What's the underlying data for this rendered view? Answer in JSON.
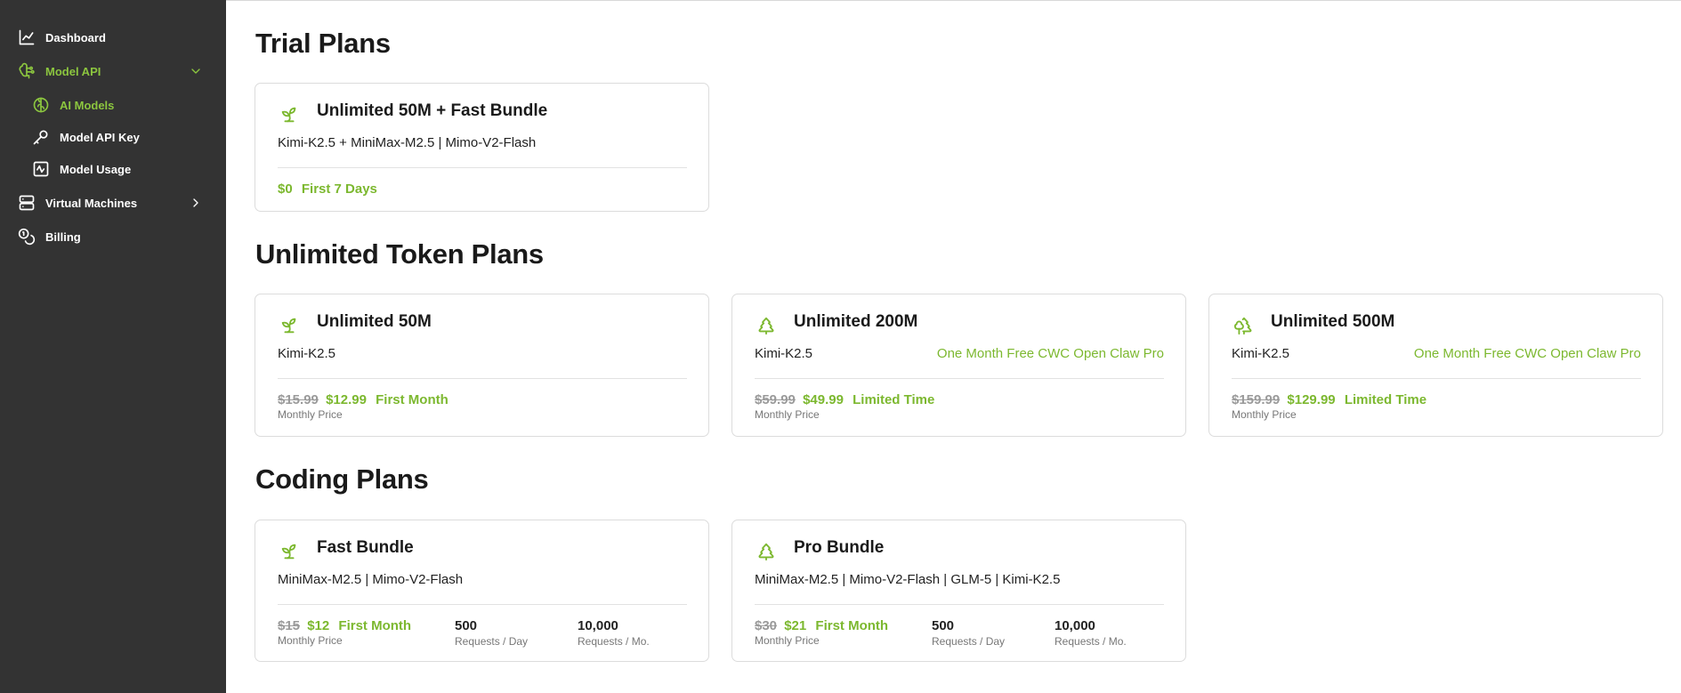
{
  "sidebar": {
    "items": [
      {
        "label": "Dashboard",
        "icon": "chart-line-icon"
      },
      {
        "label": "Model API",
        "icon": "brain-circuit-icon",
        "active": true,
        "expanded": true
      },
      {
        "label": "AI Models",
        "icon": "brain-icon",
        "active": true
      },
      {
        "label": "Model API Key",
        "icon": "key-icon"
      },
      {
        "label": "Model Usage",
        "icon": "activity-icon"
      },
      {
        "label": "Virtual Machines",
        "icon": "server-icon"
      },
      {
        "label": "Billing",
        "icon": "coins-icon"
      }
    ]
  },
  "sections": {
    "trial": {
      "title": "Trial Plans",
      "cards": [
        {
          "title": "Unlimited 50M + Fast Bundle",
          "models": "Kimi-K2.5 + MiniMax-M2.5 | Mimo-V2-Flash",
          "new_price": "$0",
          "note": "First 7 Days",
          "icon": "sprout-icon"
        }
      ]
    },
    "unlimited": {
      "title": "Unlimited Token Plans",
      "cards": [
        {
          "title": "Unlimited 50M",
          "models": "Kimi-K2.5",
          "promo": "",
          "old_price": "$15.99",
          "new_price": "$12.99",
          "note": "First Month",
          "sub": "Monthly Price",
          "icon": "sprout-icon"
        },
        {
          "title": "Unlimited 200M",
          "models": "Kimi-K2.5",
          "promo": "One Month Free CWC Open Claw Pro",
          "old_price": "$59.99",
          "new_price": "$49.99",
          "note": "Limited Time",
          "sub": "Monthly Price",
          "icon": "tree-pine-icon"
        },
        {
          "title": "Unlimited 500M",
          "models": "Kimi-K2.5",
          "promo": "One Month Free CWC Open Claw Pro",
          "old_price": "$159.99",
          "new_price": "$129.99",
          "note": "Limited Time",
          "sub": "Monthly Price",
          "icon": "trees-icon"
        }
      ]
    },
    "coding": {
      "title": "Coding Plans",
      "cards": [
        {
          "title": "Fast Bundle",
          "models": "MiniMax-M2.5 | Mimo-V2-Flash",
          "old_price": "$15",
          "new_price": "$12",
          "note": "First Month",
          "sub": "Monthly Price",
          "stat1_value": "500",
          "stat1_label": "Requests / Day",
          "stat2_value": "10,000",
          "stat2_label": "Requests / Mo.",
          "icon": "sprout-icon"
        },
        {
          "title": "Pro Bundle",
          "models": "MiniMax-M2.5 | Mimo-V2-Flash | GLM-5 | Kimi-K2.5",
          "old_price": "$30",
          "new_price": "$21",
          "note": "First Month",
          "sub": "Monthly Price",
          "stat1_value": "500",
          "stat1_label": "Requests / Day",
          "stat2_value": "10,000",
          "stat2_label": "Requests / Mo.",
          "icon": "tree-pine-icon"
        }
      ]
    }
  },
  "colors": {
    "sidebar_bg": "#333333",
    "accent": "#8cc63f",
    "price_green": "#7cb82f",
    "strike_gray": "#9a9a9a"
  }
}
